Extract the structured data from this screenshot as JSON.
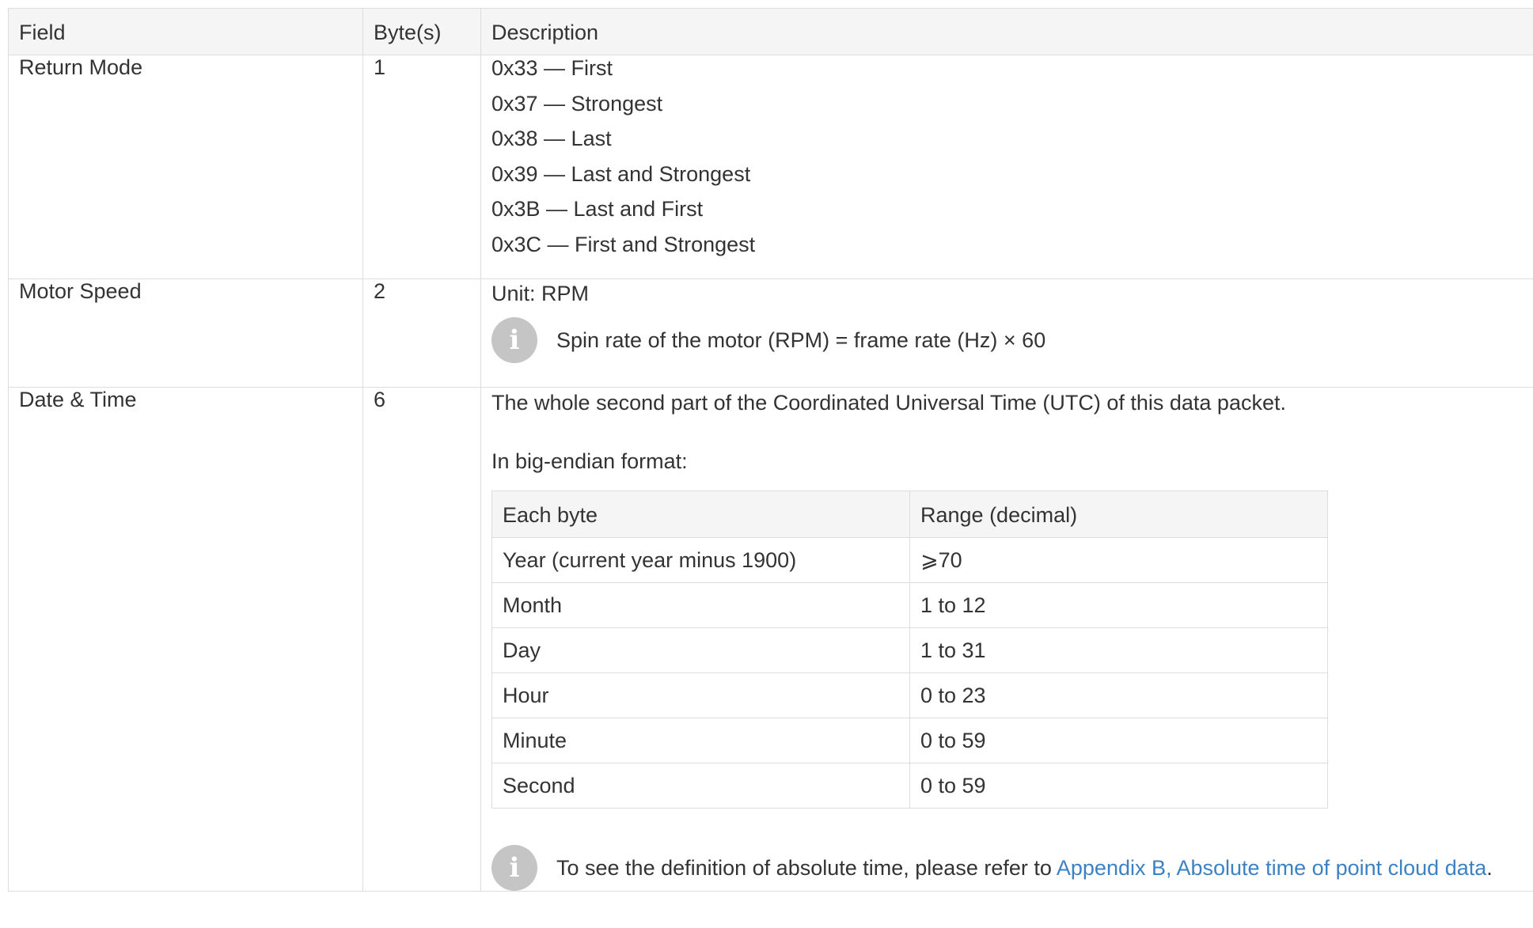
{
  "main_table": {
    "headers": {
      "field": "Field",
      "bytes": "Byte(s)",
      "description": "Description"
    },
    "return_mode": {
      "field": "Return Mode",
      "bytes": "1",
      "modes": [
        "0x33 — First",
        "0x37 — Strongest",
        "0x38 — Last",
        "0x39 — Last and Strongest",
        "0x3B — Last and First",
        "0x3C — First and Strongest"
      ]
    },
    "motor_speed": {
      "field": "Motor Speed",
      "bytes": "2",
      "unit": "Unit: RPM",
      "note": "Spin rate of the motor (RPM) = frame rate (Hz) × 60"
    },
    "date_time": {
      "field": "Date & Time",
      "bytes": "6",
      "description": "The whole second part of the Coordinated Universal Time (UTC) of this data packet.",
      "format_label": "In big-endian format:",
      "inner_table": {
        "headers": {
          "byte": "Each byte",
          "range": "Range (decimal)"
        },
        "rows": [
          {
            "byte": "Year (current year minus 1900)",
            "range": "⩾70"
          },
          {
            "byte": "Month",
            "range": "1 to 12"
          },
          {
            "byte": "Day",
            "range": "1 to 31"
          },
          {
            "byte": "Hour",
            "range": "0 to 23"
          },
          {
            "byte": "Minute",
            "range": "0 to 59"
          },
          {
            "byte": "Second",
            "range": "0 to 59"
          }
        ]
      },
      "note_prefix": "To see the definition of absolute time, please refer to ",
      "note_link": "Appendix B, Absolute time of point cloud data",
      "note_suffix": "."
    }
  },
  "icons": {
    "info_glyph": "i"
  },
  "colors": {
    "link": "#3b82c4",
    "header_bg": "#f5f5f5",
    "border": "#dddddd",
    "info_icon_bg": "#c5c5c5"
  }
}
